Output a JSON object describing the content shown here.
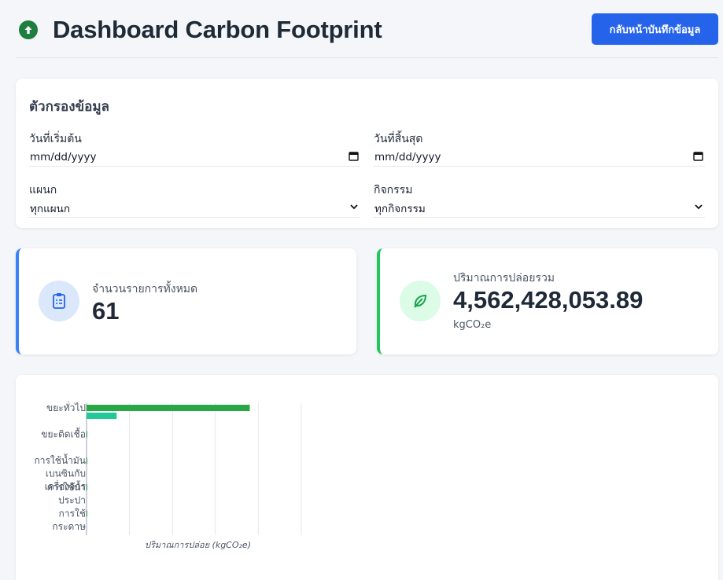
{
  "header": {
    "title": "Dashboard Carbon Footprint",
    "back_button": "กลับหน้าบันทึกข้อมูล",
    "logo_icon": "arrow-up-circle-icon"
  },
  "filters": {
    "title": "ตัวกรองข้อมูล",
    "start_date": {
      "label": "วันที่เริ่มต้น",
      "value": "mm/dd/yyyy"
    },
    "end_date": {
      "label": "วันที่สิ้นสุด",
      "value": "mm/dd/yyyy"
    },
    "department": {
      "label": "แผนก",
      "value": "ทุกแผนก"
    },
    "activity": {
      "label": "กิจกรรม",
      "value": "ทุกกิจกรรม"
    }
  },
  "stats": {
    "total_records": {
      "label": "จำนวนรายการทั้งหมด",
      "value": "61",
      "icon": "clipboard-icon",
      "accent": "#3b82f6"
    },
    "total_emission": {
      "label": "ปริมาณการปล่อยรวม",
      "value": "4,562,428,053.89",
      "unit": "kgCO₂e",
      "icon": "leaf-icon",
      "accent": "#22c55e"
    }
  },
  "chart_data": {
    "type": "bar",
    "orientation": "horizontal",
    "xlabel": "ปริมาณการปล่อย (kgCO₂e)",
    "categories": [
      "ขยะทั่วไป",
      "ขยะติดเชื้อ",
      "การใช้น้ำมันเบนซินกับเครื่องจักร",
      "การใช้น้ำประปา",
      "การใช้กระดาษ"
    ],
    "category_lines": [
      [
        "ขยะทั่วไป"
      ],
      [
        "ขยะติดเชื้อ"
      ],
      [
        "การใช้น้ำมัน",
        "เบนซินกับ",
        "เครื่องจักร"
      ],
      [
        "การใช้น้ำ",
        "ประปา"
      ],
      [
        "การใช้",
        "กระดาษ"
      ]
    ],
    "xlim": [
      0,
      5
    ],
    "series": [
      {
        "color": "#28a745",
        "values": [
          3.8,
          0.001,
          0.001,
          0.001,
          0.001
        ]
      },
      {
        "color": "#20c997",
        "values": [
          0.7,
          0,
          0,
          0,
          0
        ]
      }
    ],
    "grid": true
  }
}
